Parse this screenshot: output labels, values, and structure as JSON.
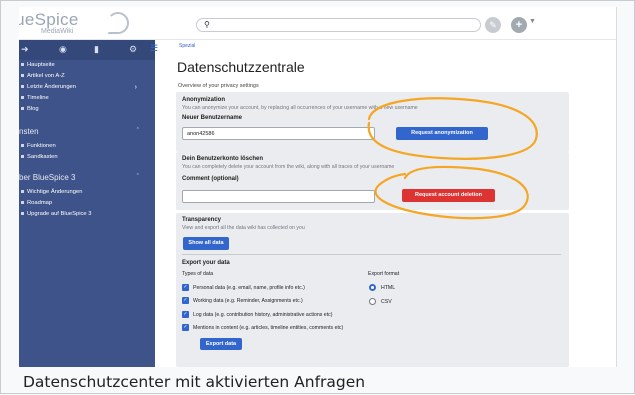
{
  "logo": {
    "name": "lueSpice",
    "sub": "MediaWiki"
  },
  "search": {
    "icon": "search-icon"
  },
  "sidebar": {
    "tabs": [
      "navigation-icon",
      "globe-icon",
      "trash-icon",
      "gear-icon"
    ],
    "main_items": [
      "Hauptseite",
      "Artikel von A-Z",
      "Letzte Änderungen",
      "Timeline",
      "Blog"
    ],
    "section1": {
      "title": "nsten",
      "items": [
        "Funktionen",
        "Sandkasten"
      ]
    },
    "section2": {
      "title": "ber BlueSpice 3",
      "items": [
        "Wichtige Änderungen",
        "Roadmap",
        "Upgrade auf BlueSpice 3"
      ]
    }
  },
  "main": {
    "breadcrumb": "Spezial",
    "title": "Datenschutzzentrale",
    "overview": "Overview of your privacy settings",
    "anon": {
      "heading": "Anonymization",
      "desc": "You can anonymize your account, by replacing all occurrences of your username with a new username",
      "label": "Neuer Benutzername",
      "value": "anon42586",
      "button": "Request anonymization"
    },
    "delete": {
      "heading": "Dein Benutzerkonto löschen",
      "desc": "You can completely delete your account from the wiki, along with all traces of your username",
      "label": "Comment (optional)",
      "value": "",
      "button": "Request account deletion"
    },
    "transparency": {
      "heading": "Transparency",
      "desc": "View and export all the data wiki has collected on you",
      "button": "Show all data"
    },
    "export": {
      "heading": "Export your data",
      "types_label": "Types of data",
      "format_label": "Export format",
      "types": [
        "Personal data (e.g. email, name, profile info etc.)",
        "Working data (e.g. Reminder, Assignments etc.)",
        "Log data (e.g. contribution history, administrative actions etc)",
        "Mentions in content (e.g. articles, timeline entities, comments etc)"
      ],
      "formats": [
        "HTML",
        "CSV"
      ],
      "selected_format": "HTML",
      "button": "Export data"
    }
  },
  "caption": "Datenschutzcenter mit aktivierten Anfragen",
  "colors": {
    "sidebar": "#3e5389",
    "accent": "#3366cc",
    "danger": "#dd3333",
    "highlight_circle": "#f5a623"
  }
}
